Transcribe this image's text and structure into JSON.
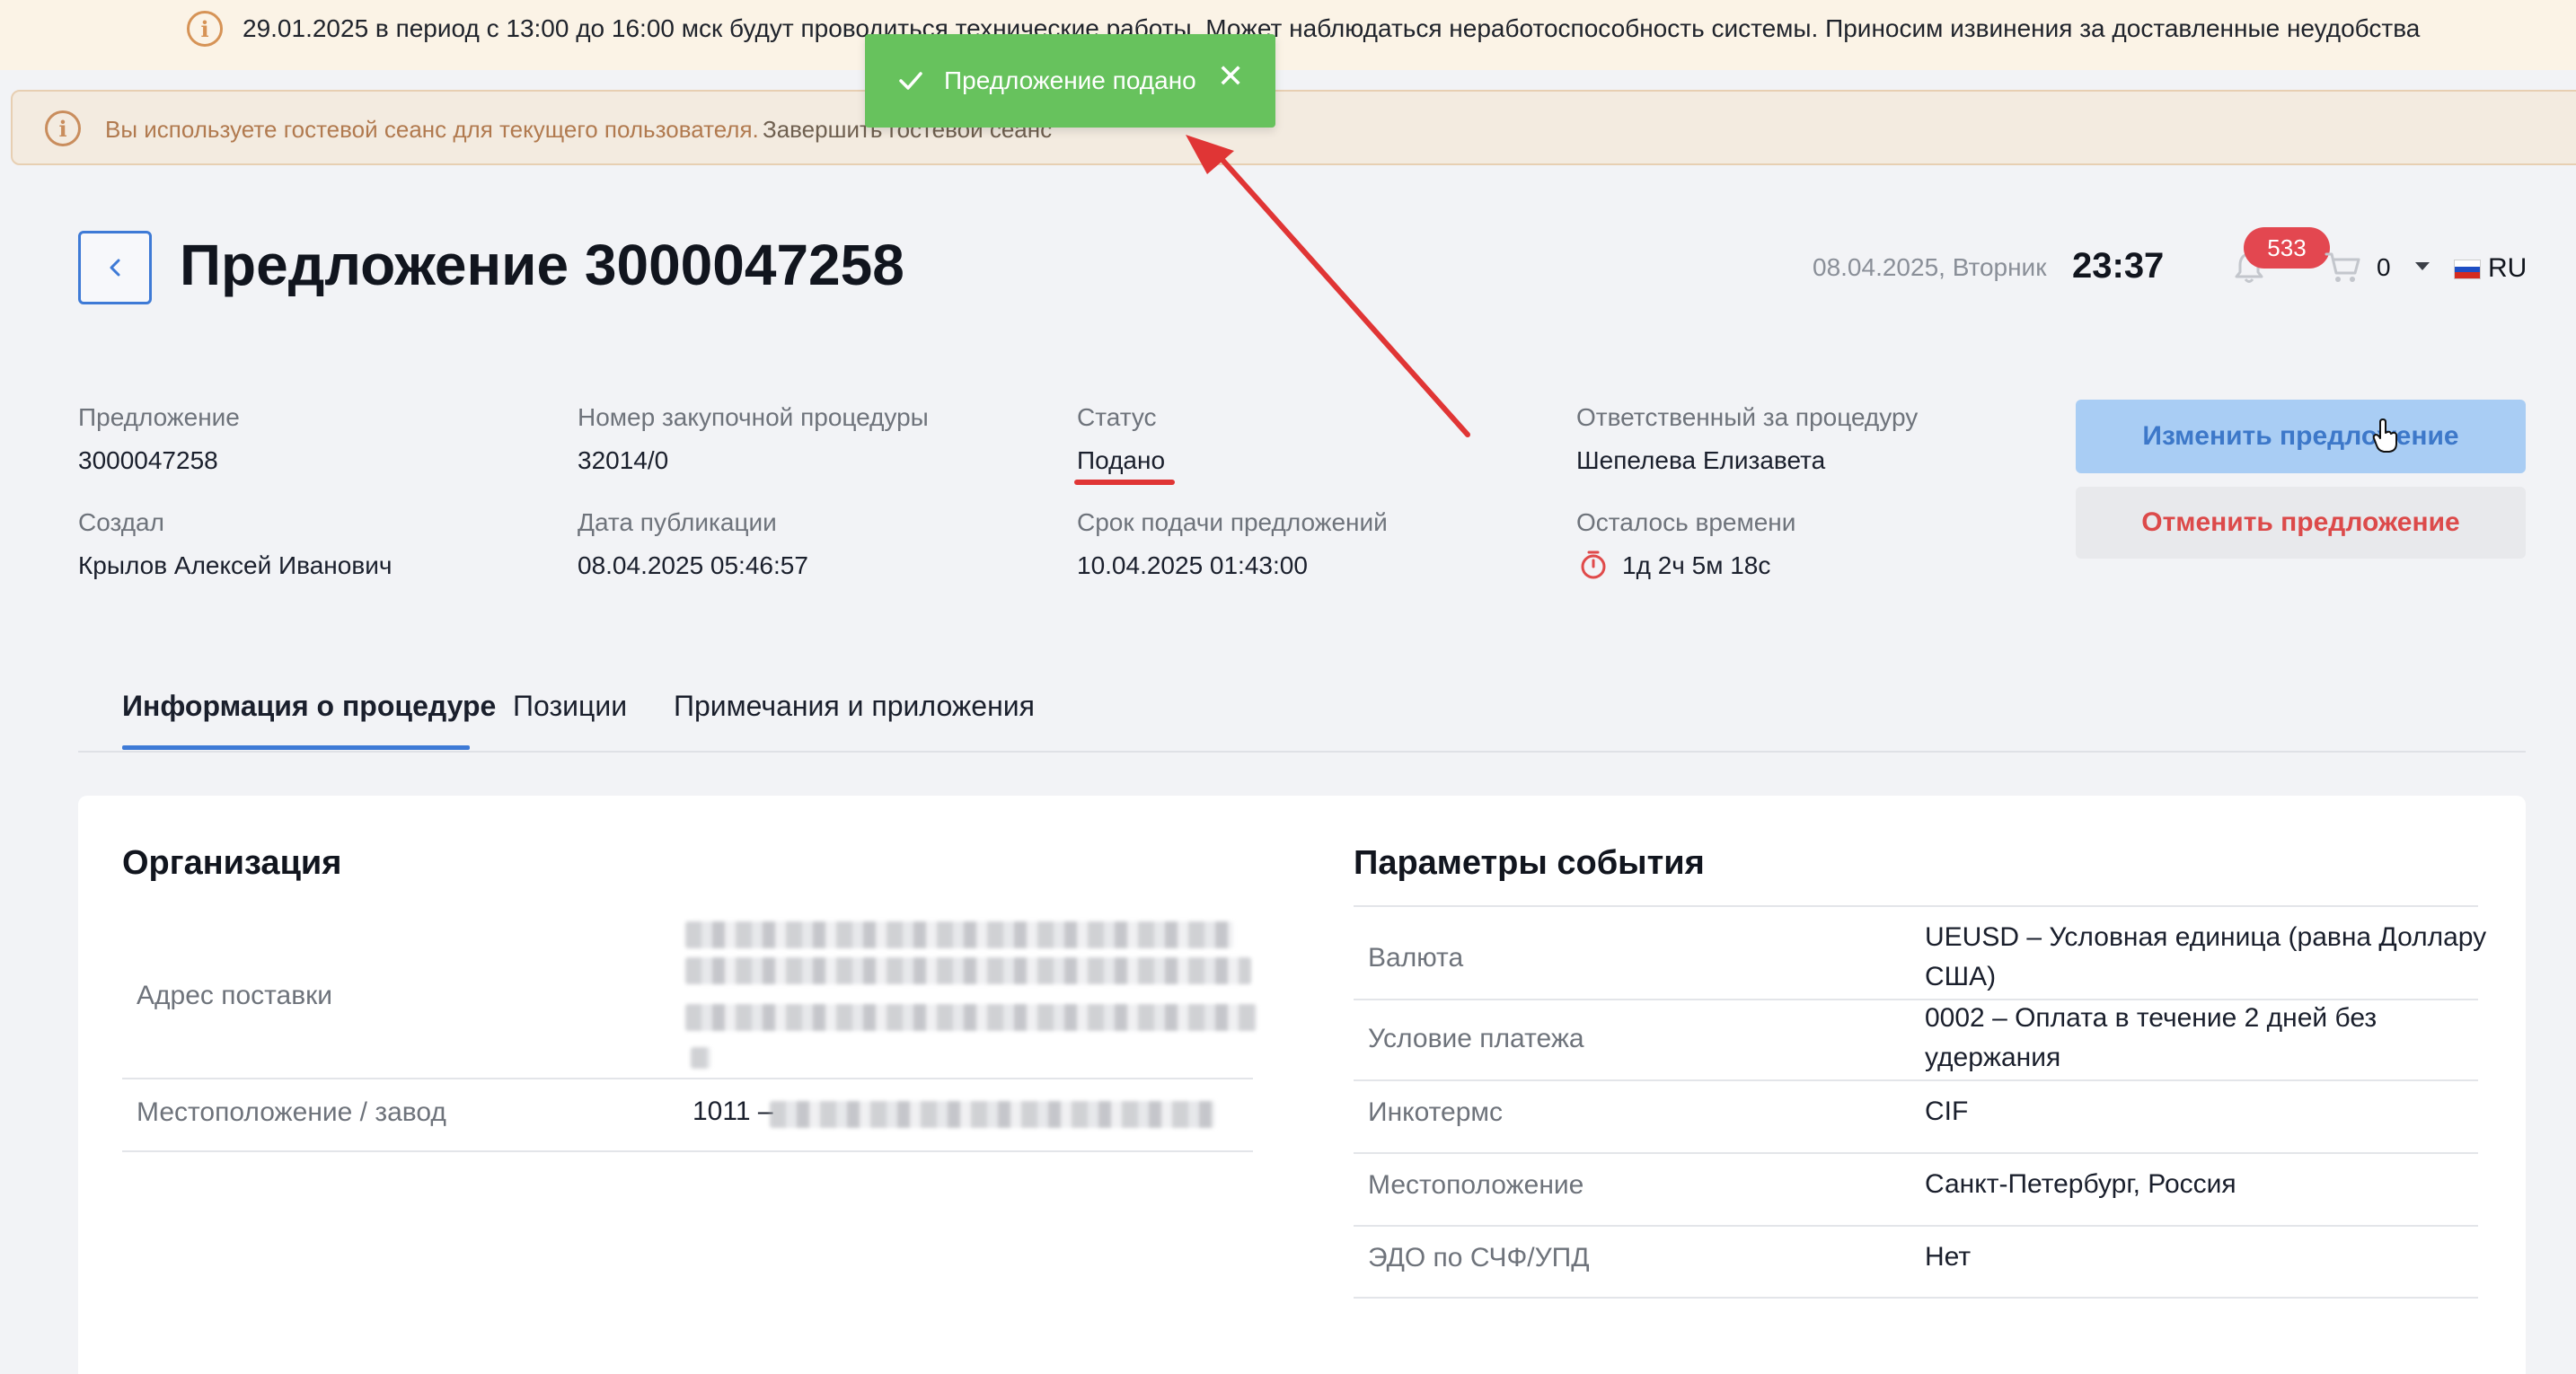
{
  "maintenance_banner": {
    "text": "29.01.2025 в период с 13:00 до 16:00 мск будут проводиться технические работы. Может наблюдаться неработоспособность системы. Приносим извинения за доставленные неудобства"
  },
  "guest_banner": {
    "text": "Вы используете гостевой сеанс для текущего пользователя.",
    "link": "Завершить гостевой сеанс"
  },
  "toast": {
    "text": "Предложение подано",
    "close": "✕",
    "color": "#67c25d"
  },
  "header": {
    "title": "Предложение 3000047258",
    "date": "08.04.2025, Вторник",
    "time": "23:37",
    "notifications_count": "533",
    "cart_count": "0",
    "language": "RU"
  },
  "summary": {
    "offer_label": "Предложение",
    "offer_value": "3000047258",
    "procedure_label": "Номер закупочной процедуры",
    "procedure_value": "32014/0",
    "status_label": "Статус",
    "status_value": "Подано",
    "responsible_label": "Ответственный за процедуру",
    "responsible_value": "Шепелева Елизавета",
    "created_label": "Создал",
    "created_value": "Крылов Алексей Иванович",
    "published_label": "Дата публикации",
    "published_value": "08.04.2025 05:46:57",
    "deadline_label": "Срок подачи предложений",
    "deadline_value": "10.04.2025 01:43:00",
    "remaining_label": "Осталось времени",
    "remaining_value": "1д 2ч 5м 18с"
  },
  "actions": {
    "change": "Изменить предложение",
    "cancel": "Отменить предложение"
  },
  "tabs": [
    {
      "label": "Информация о процедуре",
      "active": true
    },
    {
      "label": "Позиции",
      "active": false
    },
    {
      "label": "Примечания и приложения",
      "active": false
    }
  ],
  "organization": {
    "title": "Организация",
    "rows": [
      {
        "label": "Адрес поставки",
        "value": ""
      },
      {
        "label": "Местоположение / завод",
        "value": "1011 –"
      }
    ]
  },
  "event_params": {
    "title": "Параметры события",
    "rows": [
      {
        "label": "Валюта",
        "value": "UEUSD – Условная единица (равна Доллару США)"
      },
      {
        "label": "Условие платежа",
        "value": "0002 – Оплата в течение 2 дней без удержания"
      },
      {
        "label": "Инкотермс",
        "value": "CIF"
      },
      {
        "label": "Местоположение",
        "value": "Санкт-Петербург, Россия"
      },
      {
        "label": "ЭДО по СЧФ/УПД",
        "value": "Нет"
      }
    ]
  },
  "colors": {
    "accent": "#3e7ad6",
    "danger": "#e03535",
    "toast_green": "#67c25d",
    "badge_red": "#e34750"
  }
}
